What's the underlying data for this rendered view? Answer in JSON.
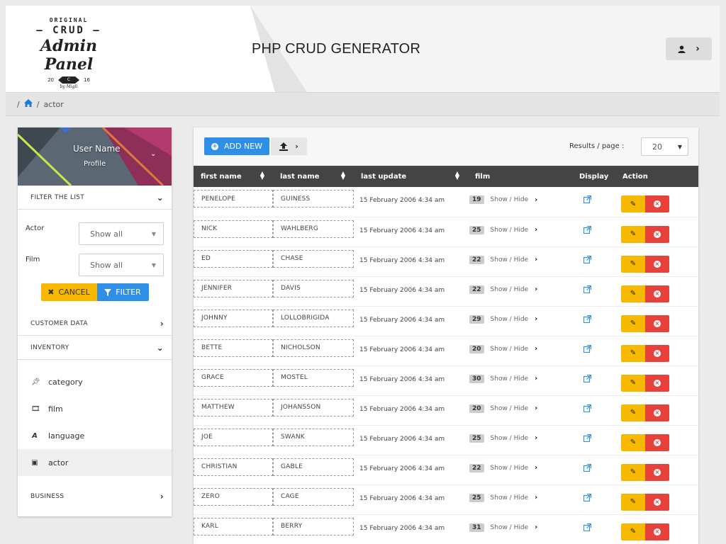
{
  "header": {
    "logo": {
      "line1": "ORIGINAL",
      "line2": "CRUD",
      "line3": "Admin Panel",
      "year_left": "20",
      "year_mark": "C",
      "year_right": "16",
      "byline": "by Migli"
    },
    "title": "PHP CRUD GENERATOR",
    "user_icon": "user-icon",
    "user_chevron": "›"
  },
  "breadcrumb": {
    "home_icon": "home-icon",
    "sep": "/",
    "current": "actor"
  },
  "sidebar": {
    "user_name": "User Name",
    "profile_label": "Profile",
    "filter_title": "FILTER THE LIST",
    "filters": [
      {
        "label": "Actor",
        "value": "Show all"
      },
      {
        "label": "Film",
        "value": "Show all"
      }
    ],
    "cancel_label": "CANCEL",
    "filter_label": "FILTER",
    "sections": {
      "customer": "CUSTOMER DATA",
      "inventory": "INVENTORY",
      "business": "BUSINESS"
    },
    "inventory_items": [
      {
        "label": "category",
        "icon": "pin-icon"
      },
      {
        "label": "film",
        "icon": "film-icon"
      },
      {
        "label": "language",
        "icon": "language-icon"
      },
      {
        "label": "actor",
        "icon": "id-card-icon"
      }
    ],
    "colors": {
      "accent": "#2f8fe6",
      "warning": "#f7b900",
      "danger": "#e8403a"
    }
  },
  "toolbar": {
    "add_label": "ADD NEW",
    "results_label": "Results / page :",
    "results_value": "20"
  },
  "table": {
    "columns": [
      "first name",
      "last name",
      "last update",
      "film",
      "Display",
      "Action"
    ],
    "film_toggle": "Show / Hide",
    "rows": [
      {
        "first": "PENELOPE",
        "last": "GUINESS",
        "update": "15 February 2006 4:34 am",
        "films": "19"
      },
      {
        "first": "NICK",
        "last": "WAHLBERG",
        "update": "15 February 2006 4:34 am",
        "films": "25"
      },
      {
        "first": "ED",
        "last": "CHASE",
        "update": "15 February 2006 4:34 am",
        "films": "22"
      },
      {
        "first": "JENNIFER",
        "last": "DAVIS",
        "update": "15 February 2006 4:34 am",
        "films": "22"
      },
      {
        "first": "JOHNNY",
        "last": "LOLLOBRIGIDA",
        "update": "15 February 2006 4:34 am",
        "films": "29"
      },
      {
        "first": "BETTE",
        "last": "NICHOLSON",
        "update": "15 February 2006 4:34 am",
        "films": "20"
      },
      {
        "first": "GRACE",
        "last": "MOSTEL",
        "update": "15 February 2006 4:34 am",
        "films": "30"
      },
      {
        "first": "MATTHEW",
        "last": "JOHANSSON",
        "update": "15 February 2006 4:34 am",
        "films": "20"
      },
      {
        "first": "JOE",
        "last": "SWANK",
        "update": "15 February 2006 4:34 am",
        "films": "25"
      },
      {
        "first": "CHRISTIAN",
        "last": "GABLE",
        "update": "15 February 2006 4:34 am",
        "films": "22"
      },
      {
        "first": "ZERO",
        "last": "CAGE",
        "update": "15 February 2006 4:34 am",
        "films": "25"
      },
      {
        "first": "KARL",
        "last": "BERRY",
        "update": "15 February 2006 4:34 am",
        "films": "31"
      }
    ]
  }
}
